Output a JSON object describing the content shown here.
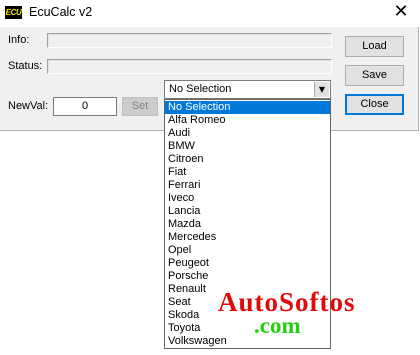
{
  "window": {
    "icon_text": "ECU",
    "title": "EcuCalc v2",
    "close_glyph": "✕"
  },
  "fields": {
    "info_label": "Info:",
    "status_label": "Status:",
    "newval_label": "NewVal:",
    "newval_value": "0"
  },
  "buttons": {
    "load": "Load",
    "save": "Save",
    "close": "Close",
    "set": "Set"
  },
  "combo": {
    "selected": "No Selection",
    "arrow_glyph": "▼",
    "options": [
      "No Selection",
      "Alfa Romeo",
      "Audi",
      "BMW",
      "Citroen",
      "Fiat",
      "Ferrari",
      "Iveco",
      "Lancia",
      "Mazda",
      "Mercedes",
      "Opel",
      "Peugeot",
      "Porsche",
      "Renault",
      "Seat",
      "Skoda",
      "Toyota",
      "Volkswagen"
    ],
    "highlighted_index": 0
  },
  "watermark": {
    "line1": "AutoSoftos",
    "line2": ".com"
  },
  "colors": {
    "selection": "#0078d7",
    "watermark_red": "#e00a0a",
    "watermark_green": "#1fd10e",
    "dialog_bg": "#f0f0f0"
  }
}
